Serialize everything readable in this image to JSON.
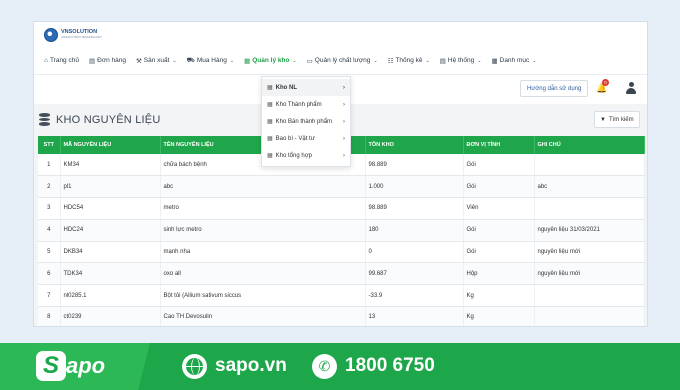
{
  "logo": {
    "name": "VNSOLUTION",
    "tagline": "VNSOLUTION TECHNOLOGY"
  },
  "menu": [
    {
      "label": "Trang chủ",
      "icon": "home-icon",
      "glyph": "⌂",
      "caret": false,
      "active": false
    },
    {
      "label": "Đơn hàng",
      "icon": "receipt-icon",
      "glyph": "▤",
      "caret": false,
      "active": false
    },
    {
      "label": "Sản xuất",
      "icon": "production-icon",
      "glyph": "⚒",
      "caret": true,
      "active": false
    },
    {
      "label": "Mua Hàng",
      "icon": "cart-icon",
      "glyph": "⛟",
      "caret": true,
      "active": false
    },
    {
      "label": "Quản lý kho",
      "icon": "warehouse-icon",
      "glyph": "▦",
      "caret": true,
      "active": true
    },
    {
      "label": "Quản lý chất lượng",
      "icon": "quality-icon",
      "glyph": "▭",
      "caret": true,
      "active": false
    },
    {
      "label": "Thống kê",
      "icon": "stats-icon",
      "glyph": "☷",
      "caret": true,
      "active": false
    },
    {
      "label": "Hệ thống",
      "icon": "system-icon",
      "glyph": "▤",
      "caret": true,
      "active": false
    },
    {
      "label": "Danh mục",
      "icon": "catalog-icon",
      "glyph": "▦",
      "caret": true,
      "active": false
    }
  ],
  "guide_label": "Hướng dẫn sử dụng",
  "notification_count": "0",
  "section_title": "KHO NGUYÊN LIỆU",
  "search_label": "Tìm kiếm",
  "dropdown": [
    {
      "label": "Kho NL",
      "selected": true
    },
    {
      "label": "Kho Thành phẩm",
      "selected": false
    },
    {
      "label": "Kho Bán thành phẩm",
      "selected": false
    },
    {
      "label": "Bao bì - Vật tư",
      "selected": false
    },
    {
      "label": "Kho tổng hợp",
      "selected": false
    }
  ],
  "table": {
    "columns": [
      "STT",
      "MÃ NGUYÊN LIỆU",
      "TÊN NGUYÊN LIỆU",
      "TỒN KHO",
      "ĐƠN VỊ TÍNH",
      "GHI CHÚ"
    ],
    "rows": [
      [
        "1",
        "KM34",
        "chữa bách bệnh",
        "98.889",
        "Gói",
        ""
      ],
      [
        "2",
        "pl1",
        "abc",
        "1.000",
        "Gói",
        "abc"
      ],
      [
        "3",
        "HDC54",
        "metro",
        "98.889",
        "Viên",
        ""
      ],
      [
        "4",
        "HDC24",
        "sinh lực metro",
        "180",
        "Gói",
        "nguyên liệu 31/03/2021"
      ],
      [
        "5",
        "DKB34",
        "mạnh nha",
        "0",
        "Gói",
        "nguyên liệu mới"
      ],
      [
        "6",
        "TDK34",
        "oxo all",
        "99.687",
        "Hộp",
        "nguyên liệu mới"
      ],
      [
        "7",
        "nl0285.1",
        "Bột tỏi (Allium sativum siccus",
        "-33.9",
        "Kg",
        ""
      ],
      [
        "8",
        "ct0239",
        "Cao TH Devosulin",
        "13",
        "Kg",
        ""
      ]
    ]
  },
  "banner": {
    "brand_first": "S",
    "brand_rest": "apo",
    "website": "sapo.vn",
    "hotline": "1800 6750",
    "brand_color": "#1ea64a"
  }
}
